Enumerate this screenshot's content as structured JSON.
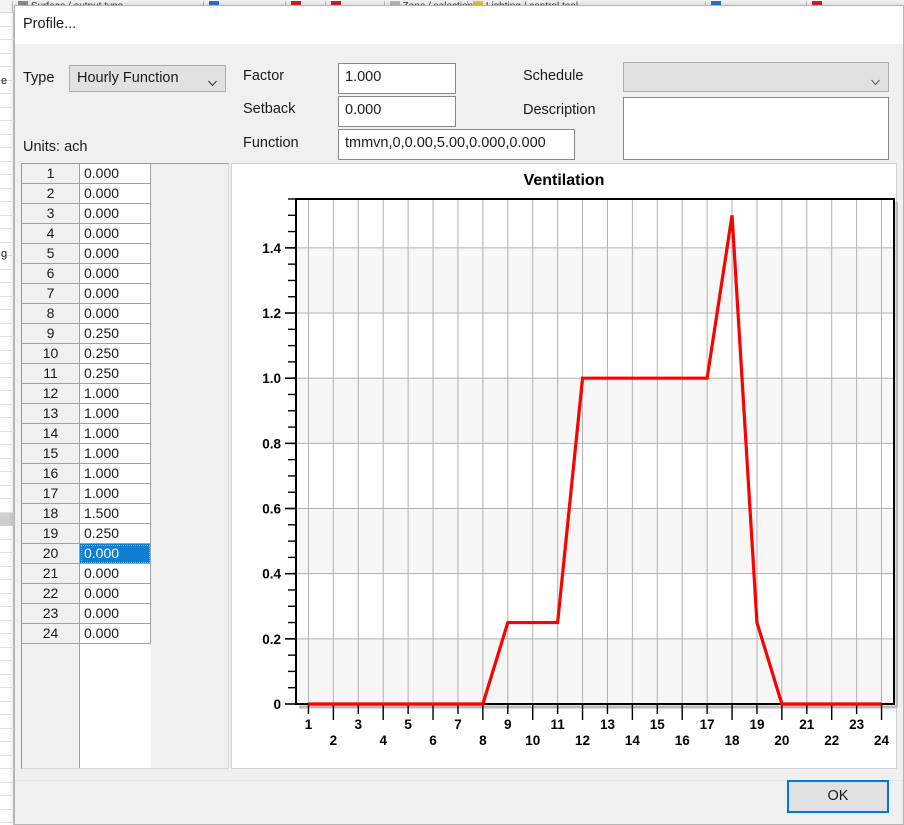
{
  "background_window": {
    "toolbar_items": [
      {
        "label": "Surface / output type",
        "x": 30,
        "swatch": "#8c8c8c"
      },
      {
        "label": "",
        "x": 352,
        "swatch": "#2b6fd6"
      },
      {
        "label": "",
        "x": 490,
        "swatch": "#d02020"
      },
      {
        "label": "",
        "x": 556,
        "swatch": "#d02020"
      },
      {
        "label": "Zone / selection",
        "x": 655,
        "swatch": "#b8b8b8"
      },
      {
        "label": "Lighting / control tool",
        "x": 795,
        "swatch": "#e8c438"
      },
      {
        "label": "",
        "x": 1195,
        "swatch": "#2b6fd6"
      },
      {
        "label": "",
        "x": 1365,
        "swatch": "#d02020"
      }
    ],
    "left_strip_labels": [
      "e",
      "g"
    ]
  },
  "dialog": {
    "title": "Profile...",
    "ok_label": "OK"
  },
  "form": {
    "type_label": "Type",
    "type_value": "Hourly Function",
    "units_label": "Units: ach",
    "factor_label": "Factor",
    "factor_value": "1.000",
    "setback_label": "Setback",
    "setback_value": "0.000",
    "function_label": "Function",
    "function_value": "tmmvn,0,0.00,5.00,0.000,0.000",
    "schedule_label": "Schedule",
    "schedule_value": "",
    "description_label": "Description",
    "description_value": ""
  },
  "table": {
    "rows": [
      {
        "hour": "1",
        "value": "0.000",
        "selected": false
      },
      {
        "hour": "2",
        "value": "0.000",
        "selected": false
      },
      {
        "hour": "3",
        "value": "0.000",
        "selected": false
      },
      {
        "hour": "4",
        "value": "0.000",
        "selected": false
      },
      {
        "hour": "5",
        "value": "0.000",
        "selected": false
      },
      {
        "hour": "6",
        "value": "0.000",
        "selected": false
      },
      {
        "hour": "7",
        "value": "0.000",
        "selected": false
      },
      {
        "hour": "8",
        "value": "0.000",
        "selected": false
      },
      {
        "hour": "9",
        "value": "0.250",
        "selected": false
      },
      {
        "hour": "10",
        "value": "0.250",
        "selected": false
      },
      {
        "hour": "11",
        "value": "0.250",
        "selected": false
      },
      {
        "hour": "12",
        "value": "1.000",
        "selected": false
      },
      {
        "hour": "13",
        "value": "1.000",
        "selected": false
      },
      {
        "hour": "14",
        "value": "1.000",
        "selected": false
      },
      {
        "hour": "15",
        "value": "1.000",
        "selected": false
      },
      {
        "hour": "16",
        "value": "1.000",
        "selected": false
      },
      {
        "hour": "17",
        "value": "1.000",
        "selected": false
      },
      {
        "hour": "18",
        "value": "1.500",
        "selected": false
      },
      {
        "hour": "19",
        "value": "0.250",
        "selected": false
      },
      {
        "hour": "20",
        "value": "0.000",
        "selected": true
      },
      {
        "hour": "21",
        "value": "0.000",
        "selected": false
      },
      {
        "hour": "22",
        "value": "0.000",
        "selected": false
      },
      {
        "hour": "23",
        "value": "0.000",
        "selected": false
      },
      {
        "hour": "24",
        "value": "0.000",
        "selected": false
      }
    ]
  },
  "colors": {
    "series_line": "#ff0000",
    "selection": "#0f7fd4",
    "focus_border": "#0078d7",
    "grid_line": "#b0b0b0",
    "band_fill": "#f7f7f7",
    "axis": "#000000"
  },
  "chart_data": {
    "type": "line",
    "title": "Ventilation",
    "xlabel": "",
    "ylabel": "",
    "x": [
      1,
      2,
      3,
      4,
      5,
      6,
      7,
      8,
      9,
      10,
      11,
      12,
      13,
      14,
      15,
      16,
      17,
      18,
      19,
      20,
      21,
      22,
      23,
      24
    ],
    "series": [
      {
        "name": "Ventilation",
        "color": "#ff0000",
        "values": [
          0.0,
          0.0,
          0.0,
          0.0,
          0.0,
          0.0,
          0.0,
          0.0,
          0.25,
          0.25,
          0.25,
          1.0,
          1.0,
          1.0,
          1.0,
          1.0,
          1.0,
          1.5,
          0.25,
          0.0,
          0.0,
          0.0,
          0.0,
          0.0
        ]
      }
    ],
    "xlim": [
      0.5,
      24.5
    ],
    "ylim": [
      0,
      1.55
    ],
    "ytick_labels": [
      "0",
      "0.2",
      "0.4",
      "0.6",
      "0.8",
      "1.0",
      "1.2",
      "1.4"
    ],
    "ytick_values": [
      0,
      0.2,
      0.4,
      0.6,
      0.8,
      1.0,
      1.2,
      1.4
    ],
    "yminor_step": 0.05,
    "xtick_labels": [
      "1",
      "2",
      "3",
      "4",
      "5",
      "6",
      "7",
      "8",
      "9",
      "10",
      "11",
      "12",
      "13",
      "14",
      "15",
      "16",
      "17",
      "18",
      "19",
      "20",
      "21",
      "22",
      "23",
      "24"
    ],
    "grid": true,
    "legend": "none",
    "units": "ach"
  }
}
